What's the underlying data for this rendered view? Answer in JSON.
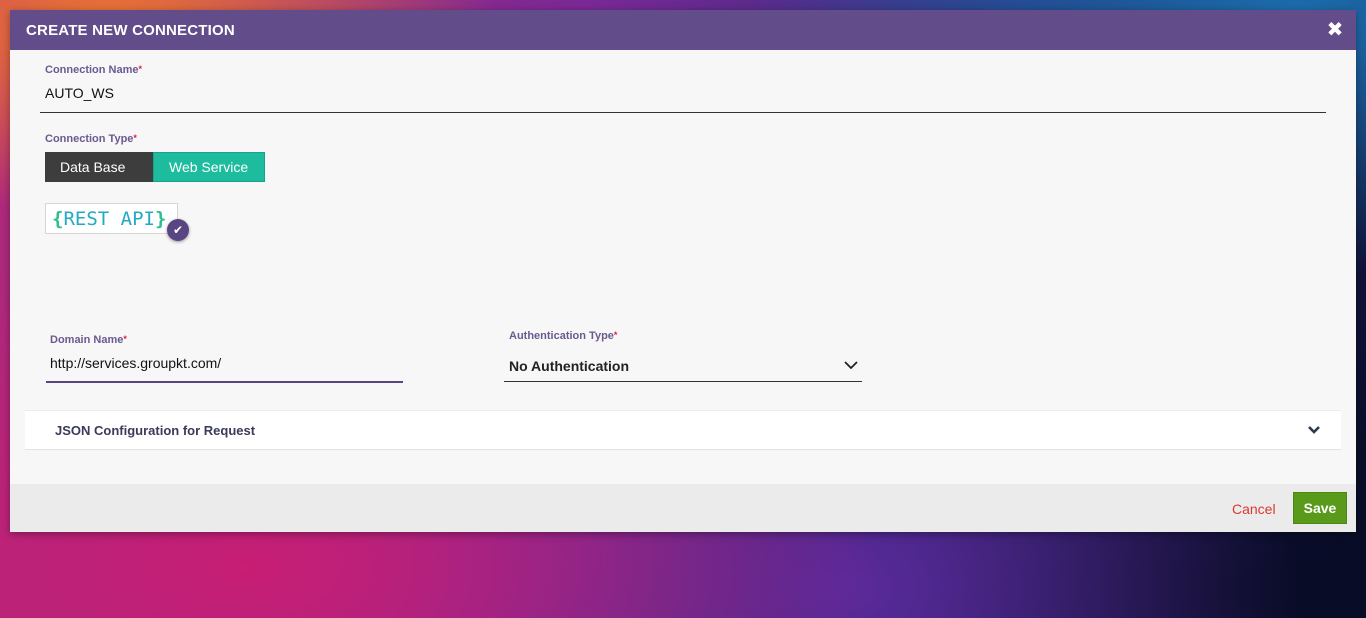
{
  "modal": {
    "title": "CREATE NEW CONNECTION",
    "close_icon": "close-icon"
  },
  "connection_name": {
    "label": "Connection Name",
    "required_mark": "*",
    "value": "AUTO_WS"
  },
  "connection_type": {
    "label": "Connection Type",
    "required_mark": "*",
    "options": [
      "Data Base",
      "Web Service"
    ],
    "selected": "Web Service"
  },
  "rest_api": {
    "open_brace": "{",
    "text": "REST API",
    "close_brace": "}",
    "selected_icon": "check-icon"
  },
  "domain_name": {
    "label": "Domain Name",
    "required_mark": "*",
    "value": "http://services.groupkt.com/"
  },
  "auth_type": {
    "label": "Authentication Type",
    "required_mark": "*",
    "value": "No Authentication"
  },
  "json_config": {
    "title": "JSON Configuration for Request"
  },
  "footer": {
    "cancel_label": "Cancel",
    "save_label": "Save"
  },
  "colors": {
    "header": "#624c8a",
    "web_service_active": "#1ebc9f",
    "data_base_inactive": "#3d3d3d",
    "save": "#5a9a1b",
    "cancel": "#d93a2f",
    "required": "#e0213f"
  }
}
